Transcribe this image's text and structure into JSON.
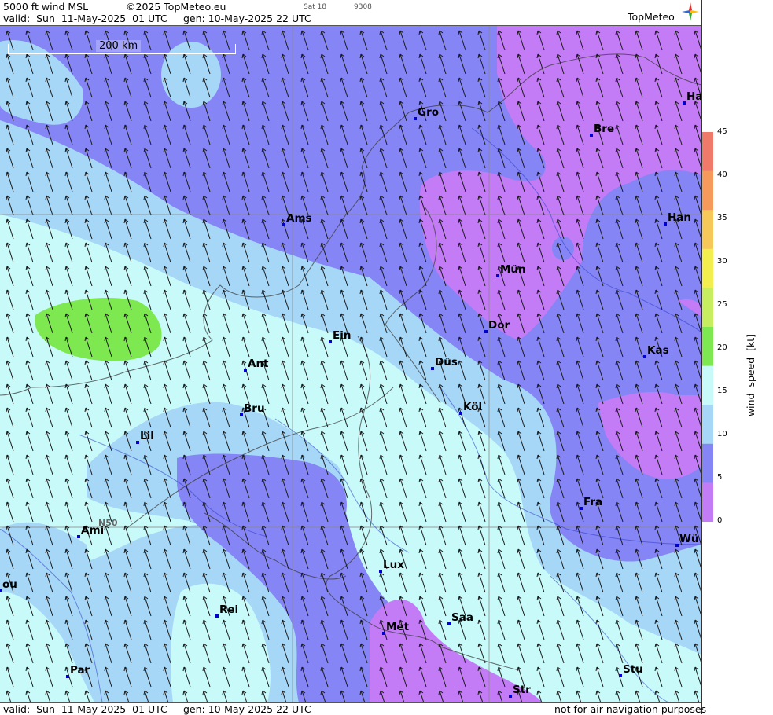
{
  "header": {
    "title": "5000 ft wind MSL",
    "copyright": "©2025 TopMeteo.eu",
    "tab_day": "Sat 18",
    "code": "9308",
    "valid": "valid:  Sun  11-May-2025  01 UTC",
    "gen": "gen: 10-May-2025 22 UTC",
    "brand": "TopMeteo"
  },
  "footer": {
    "valid": "valid:  Sun  11-May-2025  01 UTC",
    "gen": "gen: 10-May-2025 22 UTC",
    "disclaimer": "not for air navigation purposes"
  },
  "scale_bar": "200 km",
  "grid_label": "N50",
  "cities": [
    {
      "name": "Ha"
    },
    {
      "name": "Gro"
    },
    {
      "name": "Bre"
    },
    {
      "name": "Ams"
    },
    {
      "name": "Han"
    },
    {
      "name": "Mün"
    },
    {
      "name": "Dor"
    },
    {
      "name": "Kas"
    },
    {
      "name": "Ein"
    },
    {
      "name": "Ant"
    },
    {
      "name": "Düs"
    },
    {
      "name": "Köl"
    },
    {
      "name": "Bru"
    },
    {
      "name": "Lil"
    },
    {
      "name": "Fra"
    },
    {
      "name": "Ami"
    },
    {
      "name": "Wü"
    },
    {
      "name": "Lux"
    },
    {
      "name": "Rei"
    },
    {
      "name": "Saa"
    },
    {
      "name": "Met"
    },
    {
      "name": "ou"
    },
    {
      "name": "Par"
    },
    {
      "name": "Stu"
    },
    {
      "name": "Str"
    }
  ],
  "legend": {
    "title": "wind  speed  [kt]",
    "ticks": [
      "45",
      "40",
      "35",
      "30",
      "25",
      "20",
      "15",
      "10",
      "5",
      "0"
    ],
    "colors": [
      "#f07a6a",
      "#f59a5a",
      "#f6c85a",
      "#f2ee4e",
      "#c6ee5e",
      "#7ee850",
      "#c8fafa",
      "#a7d7f7",
      "#8585f5",
      "#c37cf5"
    ]
  },
  "colors": {
    "purple": "#8585f5",
    "light_blue": "#a7d7f7",
    "cyan": "#c8fafa",
    "violet": "#c37cf5",
    "green": "#7ee850",
    "city": "#0000d0"
  }
}
